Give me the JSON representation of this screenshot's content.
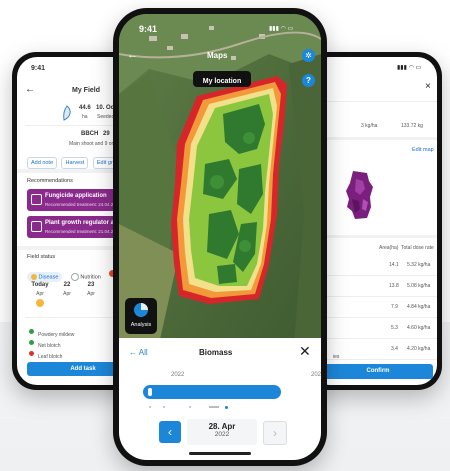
{
  "left": {
    "time": "9:41",
    "title": "My Field",
    "stat_area_value": "44.6",
    "stat_area_unit": "ha",
    "stat_date_value": "10. Oct",
    "stat_date_label": "Seeded",
    "bbch_label": "BBCH",
    "bbch_value": "29",
    "bbch_desc": "Main shoot and 9 or more",
    "actions": [
      "Add note",
      "Harvest",
      "Edit growth s"
    ],
    "recommendations_title": "Recommendations",
    "recs": [
      {
        "title": "Fungicide application",
        "sub": "Recommended treatment: 24.04.2"
      },
      {
        "title": "Plant growth regulator appl",
        "sub": "Recommended treatment: 21.04.2"
      }
    ],
    "field_status_title": "Field status",
    "status_tabs": [
      "Disease",
      "Nutrition"
    ],
    "days": [
      {
        "num": "Today",
        "month": ""
      },
      {
        "num": "22",
        "month": "Apr"
      },
      {
        "num": "23",
        "month": "Apr"
      }
    ],
    "today_month": "Apr",
    "diseases": [
      {
        "name": "Powdery mildew",
        "color": "#2e9e3e"
      },
      {
        "name": "Net blotch",
        "color": "#2e9e3e"
      },
      {
        "name": "Leaf blotch",
        "color": "#d9342b"
      }
    ],
    "add_task": "Add task"
  },
  "center": {
    "time": "9:41",
    "title": "Maps",
    "my_location": "My location",
    "analysis": "Analysis",
    "panel_back": "All",
    "panel_title": "Biomass",
    "year_label": "2022",
    "year_label_right": "202",
    "date_day": "28. Apr",
    "date_year": "2022"
  },
  "right": {
    "rate_value": "3 kg/ha",
    "rate_total": "133.72 kg",
    "edit_map": "Edit map",
    "col_area": "Area(ha)",
    "col_total": "Total dose rate",
    "rows": [
      {
        "area": "14.1",
        "rate": "5.32 kg/ha"
      },
      {
        "area": "13.8",
        "rate": "5.08 kg/ha"
      },
      {
        "area": "7.9",
        "rate": "4.84 kg/ha"
      },
      {
        "area": "5.3",
        "rate": "4.60 kg/ha"
      },
      {
        "area": "3.4",
        "rate": "4.20 kg/ha"
      }
    ],
    "footer_fragment": "ies",
    "confirm": "Confirm"
  },
  "colors": {
    "accent": "#1c87d9",
    "recommendation": "#8a2a8c",
    "field_dark_green": "#2f7a2f",
    "field_light_green": "#8cc63f",
    "field_yellow": "#f3e08a",
    "field_orange": "#f29a3a",
    "field_red": "#d7262a"
  }
}
